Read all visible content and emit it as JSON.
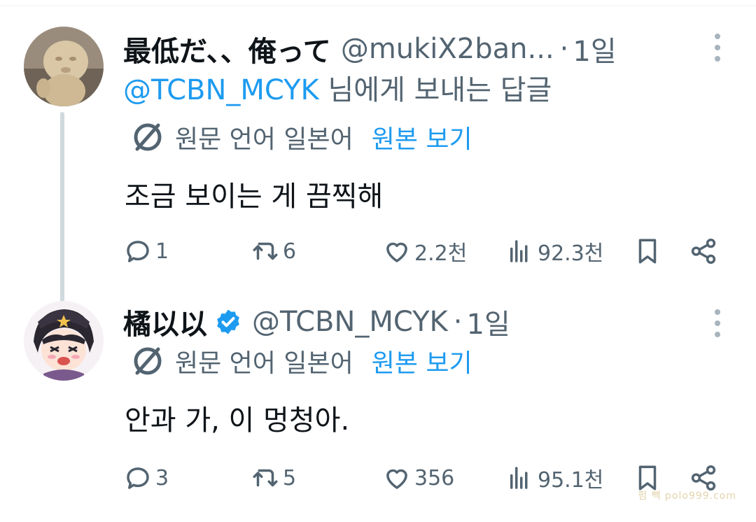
{
  "tweets": [
    {
      "display_name": "最低だ、、俺って",
      "handle": "@mukiX2ban...",
      "dot": "·",
      "time": "1일",
      "reply_to_mention": "@TCBN_MCYK",
      "reply_to_suffix": " 님에게 보내는 답글",
      "translate_source": "원문 언어 일본어",
      "translate_show": "원본 보기",
      "text": "조금 보이는 게 끔찍해",
      "stats": {
        "replies": "1",
        "retweets": "6",
        "likes": "2.2천",
        "views": "92.3천"
      },
      "verified": false
    },
    {
      "display_name": "橘以以",
      "handle": "@TCBN_MCYK",
      "dot": "·",
      "time": "1일",
      "translate_source": "원문 언어 일본어",
      "translate_show": "원본 보기",
      "text": "안과 가, 이 멍청아.",
      "stats": {
        "replies": "3",
        "retweets": "5",
        "likes": "356",
        "views": "95.1천"
      },
      "verified": true
    }
  ],
  "watermark": "펌 빽 polo999.com",
  "colors": {
    "accent": "#1d9bf0",
    "secondary_text": "#536471",
    "primary_text": "#0f1419",
    "thread_line": "#cfd9de"
  },
  "icons": [
    "more-vertical-icon",
    "translate-globe-icon",
    "reply-icon",
    "retweet-icon",
    "like-icon",
    "views-icon",
    "bookmark-icon",
    "share-icon",
    "verified-badge-icon"
  ]
}
